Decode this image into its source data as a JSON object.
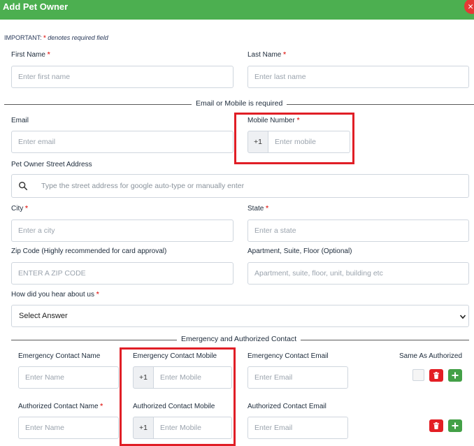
{
  "header": {
    "title": "Add Pet Owner",
    "close_label": "×",
    "accent_color": "#4caf50",
    "close_color": "#e53935"
  },
  "note": {
    "prefix": "IMPORTANT: ",
    "required_mark": "*",
    "suffix": " denotes required field"
  },
  "required_mark": "*",
  "fields": {
    "first_name": {
      "label": "First Name",
      "placeholder": "Enter first name",
      "required": true
    },
    "last_name": {
      "label": "Last Name",
      "placeholder": "Enter last name",
      "required": true
    },
    "email": {
      "label": "Email",
      "placeholder": "Enter email"
    },
    "mobile": {
      "label": "Mobile Number",
      "prefix": "+1",
      "placeholder": "Enter mobile",
      "required": true
    },
    "street": {
      "label": "Pet Owner Street Address",
      "placeholder": "Type the street address for google auto-type or manually enter"
    },
    "city": {
      "label": "City",
      "placeholder": "Enter a city",
      "required": true
    },
    "state": {
      "label": "State",
      "placeholder": "Enter a state",
      "required": true
    },
    "zip": {
      "label": "Zip Code (Highly recommended for card approval)",
      "placeholder": "ENTER A ZIP CODE"
    },
    "apartment": {
      "label": "Apartment, Suite, Floor (Optional)",
      "placeholder": "Apartment, suite, floor, unit, building etc"
    },
    "hear_about": {
      "label": "How did you hear about us",
      "selected": "Select Answer",
      "required": true
    }
  },
  "dividers": {
    "email_mobile": "Email or Mobile is required",
    "contacts": "Emergency and Authorized Contact"
  },
  "contacts": {
    "emergency": {
      "name_label": "Emergency Contact Name",
      "name_placeholder": "Enter Name",
      "mobile_label": "Emergency Contact Mobile",
      "mobile_prefix": "+1",
      "mobile_placeholder": "Enter Mobile",
      "email_label": "Emergency Contact Email",
      "email_placeholder": "Enter Email"
    },
    "authorized": {
      "name_label": "Authorized Contact Name",
      "name_required": true,
      "name_placeholder": "Enter Name",
      "mobile_label": "Authorized Contact Mobile",
      "mobile_prefix": "+1",
      "mobile_placeholder": "Enter Mobile",
      "email_label": "Authorized Contact Email",
      "email_placeholder": "Enter Email"
    },
    "same_as_authorized_label": "Same As Authorized",
    "delete_color": "#e31e24",
    "add_color": "#43a047"
  },
  "icons": [
    "close-icon",
    "search-icon",
    "chevron-down-icon",
    "trash-icon",
    "plus-icon"
  ],
  "highlight_color": "#e01e26"
}
